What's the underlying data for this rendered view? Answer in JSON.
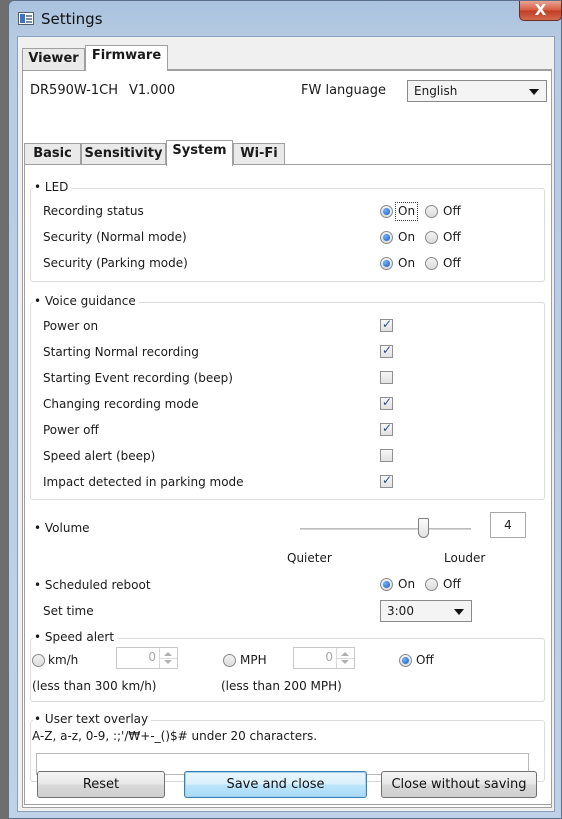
{
  "window": {
    "title": "Settings",
    "close_label": "X"
  },
  "top_tabs": [
    {
      "label": "Viewer"
    },
    {
      "label": "Firmware"
    }
  ],
  "firmware": {
    "model": "DR590W-1CH",
    "version": "V1.000",
    "fw_language_label": "FW language",
    "fw_language_value": "English"
  },
  "sub_tabs": [
    {
      "label": "Basic"
    },
    {
      "label": "Sensitivity"
    },
    {
      "label": "System"
    },
    {
      "label": "Wi-Fi"
    }
  ],
  "led": {
    "title": "LED",
    "rows": [
      {
        "label": "Recording status",
        "on_label": "On",
        "off_label": "Off",
        "selected": "On"
      },
      {
        "label": "Security (Normal mode)",
        "on_label": "On",
        "off_label": "Off",
        "selected": "On"
      },
      {
        "label": "Security (Parking mode)",
        "on_label": "On",
        "off_label": "Off",
        "selected": "On"
      }
    ]
  },
  "voice": {
    "title": "Voice guidance",
    "items": [
      {
        "label": "Power on",
        "checked": true
      },
      {
        "label": "Starting Normal recording",
        "checked": true
      },
      {
        "label": "Starting Event recording (beep)",
        "checked": false
      },
      {
        "label": "Changing recording mode",
        "checked": true
      },
      {
        "label": "Power off",
        "checked": true
      },
      {
        "label": "Speed alert (beep)",
        "checked": false
      },
      {
        "label": "Impact detected in parking mode",
        "checked": true
      }
    ]
  },
  "volume": {
    "label": "Volume",
    "value": "4",
    "level_fraction": 0.75,
    "quieter_label": "Quieter",
    "louder_label": "Louder"
  },
  "reboot": {
    "label": "Scheduled reboot",
    "on_label": "On",
    "off_label": "Off",
    "selected": "On",
    "set_time_label": "Set time",
    "time_value": "3:00"
  },
  "speed_alert": {
    "title": "Speed alert",
    "kmh_label": "km/h",
    "kmh_value": "0",
    "kmh_note": "(less than 300 km/h)",
    "mph_label": "MPH",
    "mph_value": "0",
    "mph_note": "(less than 200 MPH)",
    "off_label": "Off",
    "selected": "Off"
  },
  "overlay": {
    "title": "User text overlay",
    "hint": "A-Z, a-z, 0-9, :;'/₩+-_()$# under 20 characters.",
    "value": ""
  },
  "buttons": {
    "reset": "Reset",
    "save": "Save and close",
    "close": "Close without saving"
  }
}
